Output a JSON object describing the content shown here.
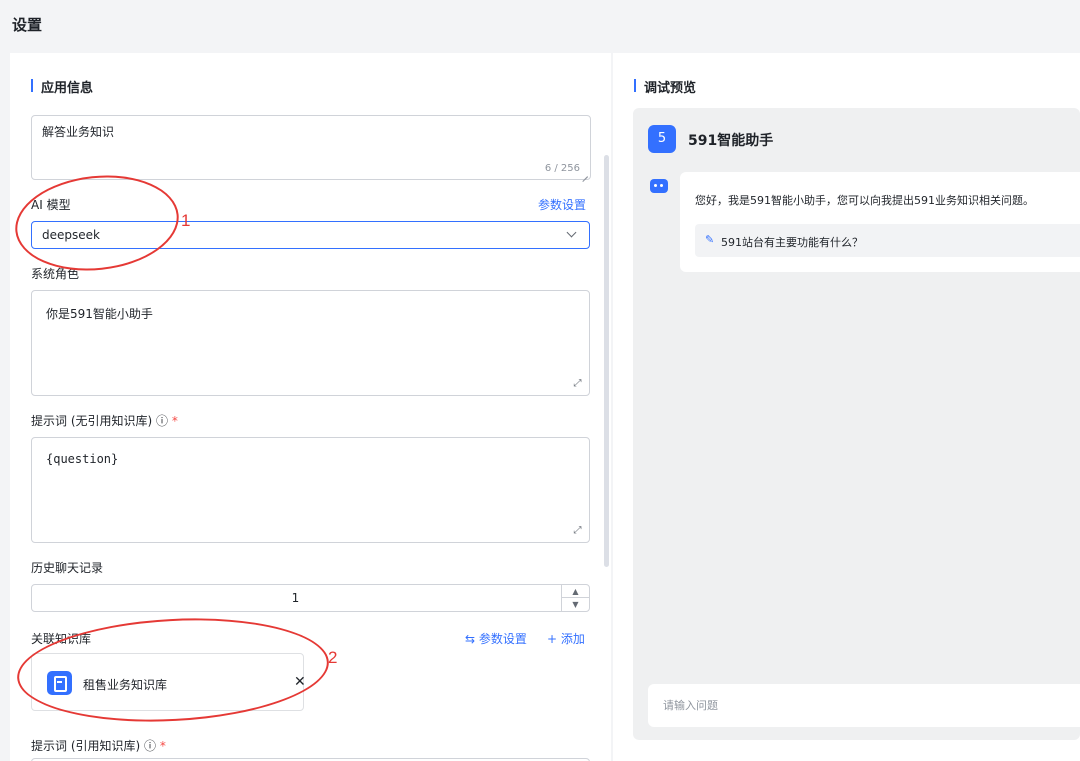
{
  "page": {
    "title": "设置"
  },
  "app_info": {
    "section_title": "应用信息",
    "description": {
      "value": "解答业务知识",
      "counter": "6 / 256"
    },
    "ai_model": {
      "label": "AI 模型",
      "params_link": "参数设置",
      "selected": "deepseek"
    },
    "system_role": {
      "label": "系统角色",
      "value": "你是591智能小助手"
    },
    "prompt_no_kb": {
      "label": "提示词 (无引用知识库)",
      "required_mark": "*",
      "value": "{question}"
    },
    "history": {
      "label": "历史聊天记录",
      "value": "1"
    },
    "knowledge_base": {
      "label": "关联知识库",
      "params_link": "参数设置",
      "add_link": "添加",
      "items": [
        {
          "name": "租售业务知识库"
        }
      ]
    },
    "prompt_with_kb": {
      "label": "提示词 (引用知识库)",
      "required_mark": "*"
    }
  },
  "annotations": {
    "one": "1",
    "two": "2",
    "color": "#e53935"
  },
  "preview": {
    "section_title": "调试预览",
    "app_badge": "5",
    "app_name": "591智能助手",
    "greeting": "您好，我是591智能小助手，您可以向我提出591业务知识相关问题。",
    "suggested_question": "591站台有主要功能有什么？",
    "input_placeholder": "请输入问题"
  },
  "colors": {
    "accent": "#3370ff",
    "required": "#f54a45"
  }
}
